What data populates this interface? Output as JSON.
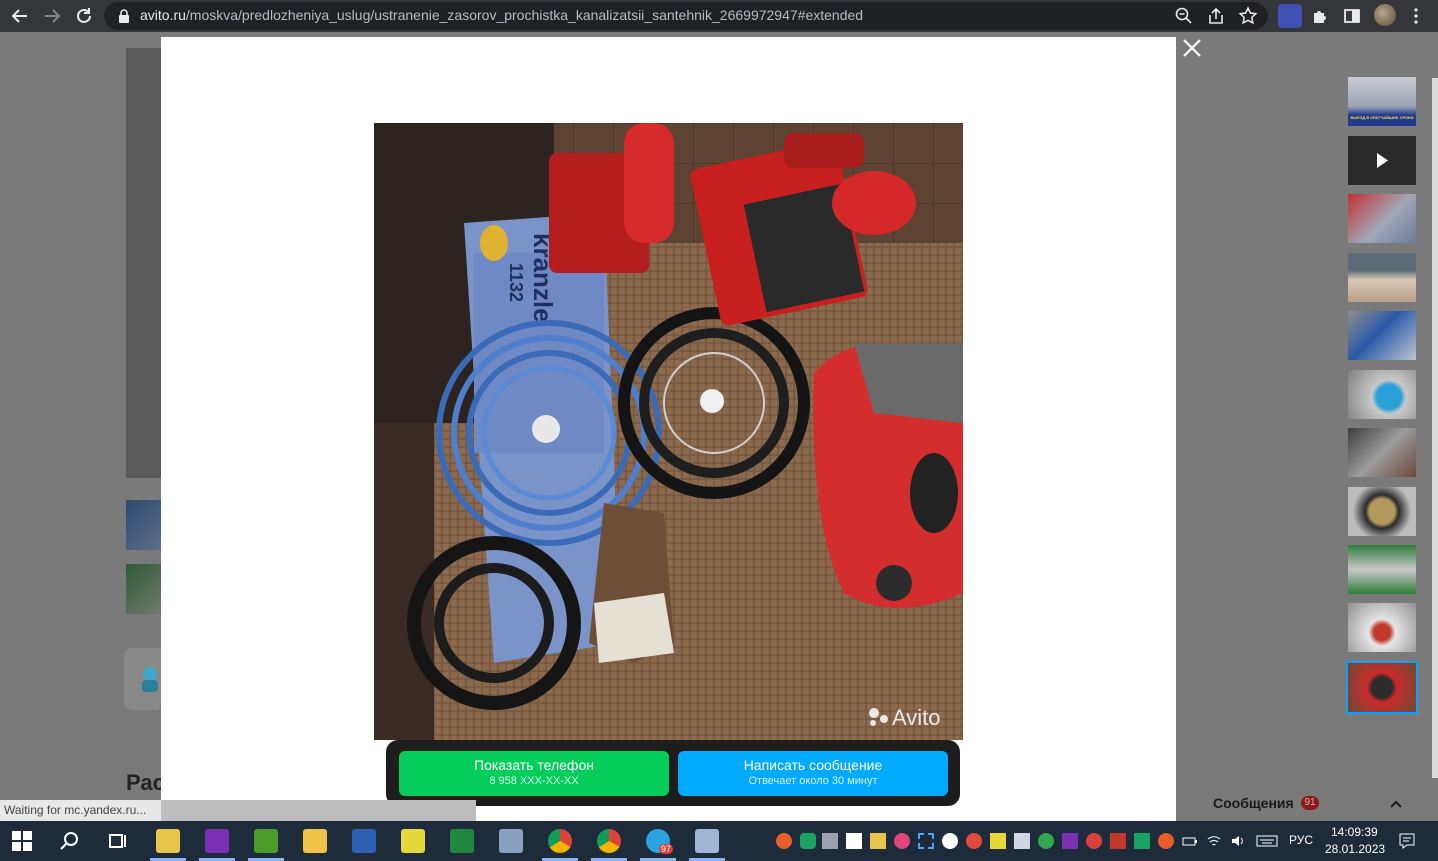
{
  "browser": {
    "url_host": "avito.ru",
    "url_path": "/moskva/predlozheniya_uslug/ustranenie_zasorov_prochistka_kanalizatsii_santehnik_2669972947#extended"
  },
  "page": {
    "heading_partial": "Рас"
  },
  "photo": {
    "brand_text": "kranzle",
    "model_text": "1132",
    "watermark": "Avito"
  },
  "actions": {
    "phone_label": "Показать телефон",
    "phone_number": "8 958 XXX-XX-XX",
    "message_label": "Написать сообщение",
    "message_sub": "Отвечает около 30 минут"
  },
  "thumbnails": [
    {
      "name": "thumb-1",
      "caption": "ВЫЕЗД В КРАТЧАЙШИЕ СРОКИ"
    },
    {
      "name": "thumb-video"
    },
    {
      "name": "thumb-3"
    },
    {
      "name": "thumb-4"
    },
    {
      "name": "thumb-5"
    },
    {
      "name": "thumb-6"
    },
    {
      "name": "thumb-7"
    },
    {
      "name": "thumb-8"
    },
    {
      "name": "thumb-9"
    },
    {
      "name": "thumb-10"
    },
    {
      "name": "thumb-11",
      "selected": true
    }
  ],
  "status": {
    "text": "Waiting for mc.yandex.ru..."
  },
  "messages": {
    "label": "Сообщения",
    "count": "91"
  },
  "taskbar": {
    "telegram_badge": "97",
    "language": "РУС",
    "time": "14:09:39",
    "date": "28.01.2023"
  },
  "colors": {
    "phone_button": "#04cd5c",
    "message_button": "#00aaff",
    "cta_bar": "#1d1d1d",
    "toolbar": "#35363a",
    "taskbar": "#1d2b3a"
  }
}
